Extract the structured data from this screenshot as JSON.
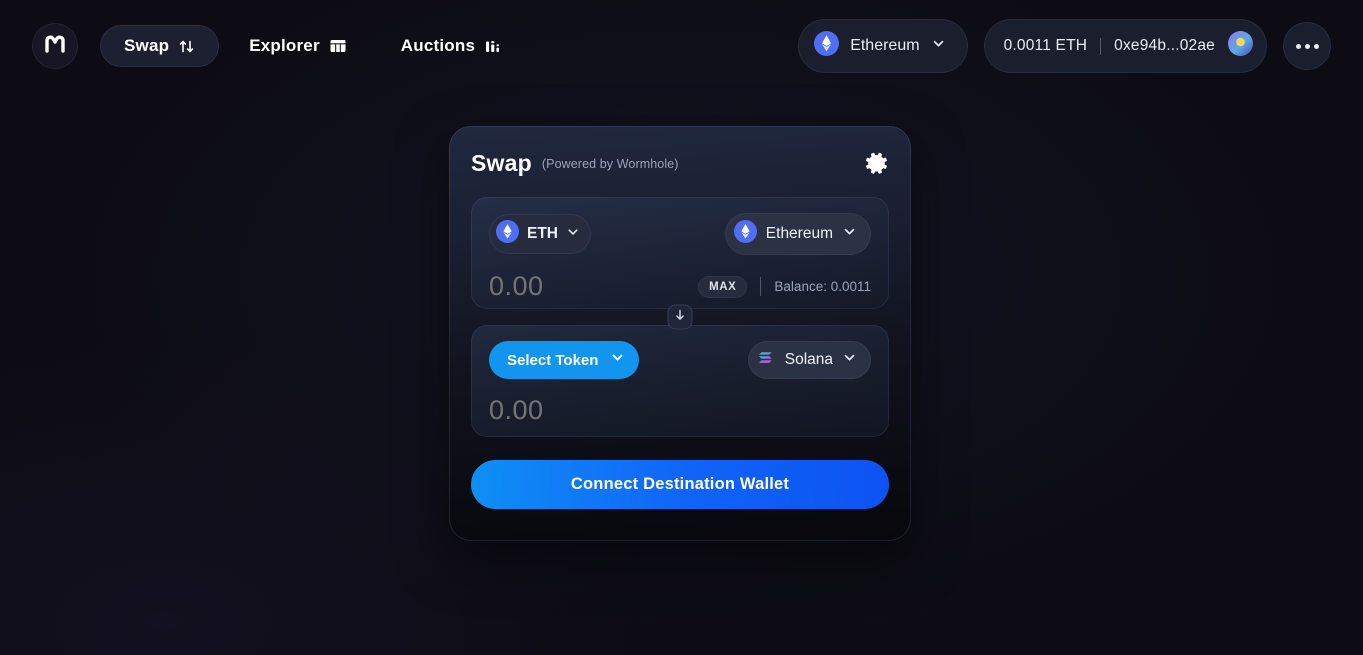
{
  "nav": {
    "logo_icon": "m-logo-icon",
    "items": [
      {
        "label": "Swap",
        "icon": "swap-arrows-icon",
        "active": true
      },
      {
        "label": "Explorer",
        "icon": "table-grid-icon",
        "active": false
      },
      {
        "label": "Auctions",
        "icon": "bar-chart-icon",
        "active": false
      }
    ]
  },
  "wallet": {
    "chain": "Ethereum",
    "chain_icon": "ethereum-icon",
    "chevron_icon": "chevron-down-icon",
    "balance": "0.0011 ETH",
    "address": "0xe94b...02ae",
    "avatar_icon": "wallet-avatar-icon",
    "more_icon": "more-horizontal-icon"
  },
  "card": {
    "title": "Swap",
    "subtitle": "(Powered by Wormhole)",
    "settings_icon": "gear-icon",
    "switch_icon": "arrow-down-icon",
    "from": {
      "token": "ETH",
      "token_icon": "ethereum-icon",
      "chain": "Ethereum",
      "chain_icon": "ethereum-icon",
      "amount_placeholder": "0.00",
      "amount_value": "",
      "max_label": "MAX",
      "balance_label": "Balance: 0.0011"
    },
    "to": {
      "token": "Select Token",
      "chain": "Solana",
      "chain_icon": "solana-icon",
      "amount_placeholder": "0.00",
      "amount_value": ""
    },
    "cta_label": "Connect Destination Wallet"
  },
  "colors": {
    "background": "#0d0c14",
    "card_top": "#20283e",
    "card_bottom": "#07070c",
    "accent_blue": "#1064f7",
    "select_token_blue": "#1295ee",
    "muted_text": "#9aa3b8"
  }
}
